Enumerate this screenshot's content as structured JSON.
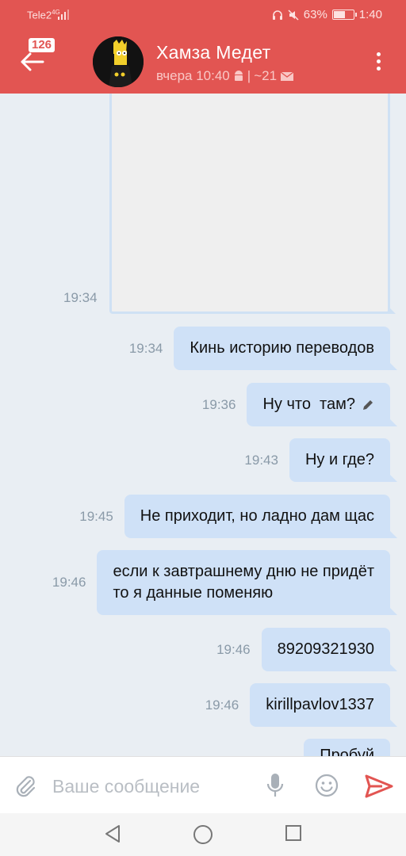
{
  "status_bar": {
    "carrier": "Tele2",
    "network": "4G",
    "battery": "63%",
    "battery_level": 0.63,
    "time": "1:40"
  },
  "header": {
    "unread_count": "126",
    "contact_name": "Хамза Медет",
    "last_seen": "вчера 10:40",
    "separator": "|",
    "mail_count": "~21"
  },
  "photo_message": {
    "time": "19:34"
  },
  "messages": [
    {
      "time": "19:34",
      "text": "Кинь историю переводов"
    },
    {
      "time": "19:36",
      "text": "Ну что  там?"
    },
    {
      "time": "19:43",
      "text": "Ну и где?"
    },
    {
      "time": "19:45",
      "text": "Не приходит, но ладно дам щас"
    },
    {
      "time": "19:46",
      "line1": "если к завтрашнему дню не придёт",
      "line2": "то я данные поменяю"
    },
    {
      "time": "19:46",
      "text": "89209321930"
    },
    {
      "time": "19:46",
      "text": "kirillpavlov1337"
    },
    {
      "text": "Пробуй"
    }
  ],
  "composer": {
    "placeholder": "Ваше сообщение"
  },
  "colors": {
    "header": "#e25552",
    "bubble": "#cfe1f7",
    "background": "#e9eef3",
    "send": "#e25552"
  },
  "icons": [
    "back-arrow-icon",
    "android-icon",
    "mail-icon",
    "more-vert-icon",
    "edit-pencil-icon",
    "paperclip-icon",
    "microphone-icon",
    "emoji-icon",
    "send-icon",
    "nav-back-icon",
    "nav-home-icon",
    "nav-recents-icon"
  ]
}
